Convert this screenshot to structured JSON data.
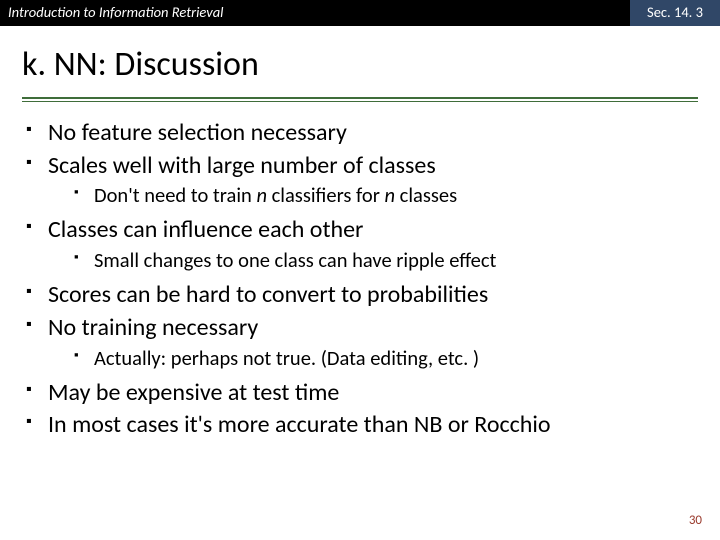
{
  "header": {
    "course": "Introduction to Information Retrieval",
    "section": "Sec. 14. 3"
  },
  "title": "k. NN: Discussion",
  "bullets": {
    "b1": "No feature selection necessary",
    "b2": "Scales well with large number of classes",
    "b2a_pre": "Don't need to train ",
    "b2a_n1": "n",
    "b2a_mid": " classifiers for ",
    "b2a_n2": "n",
    "b2a_post": " classes",
    "b3": "Classes can influence each other",
    "b3a": "Small changes to one class can have ripple effect",
    "b4": "Scores can be hard to convert to probabilities",
    "b5": "No training necessary",
    "b5a": "Actually: perhaps not true.  (Data editing, etc. )",
    "b6": "May be expensive at test time",
    "b7": "In most cases it's more accurate than NB or Rocchio"
  },
  "page_number": "30"
}
